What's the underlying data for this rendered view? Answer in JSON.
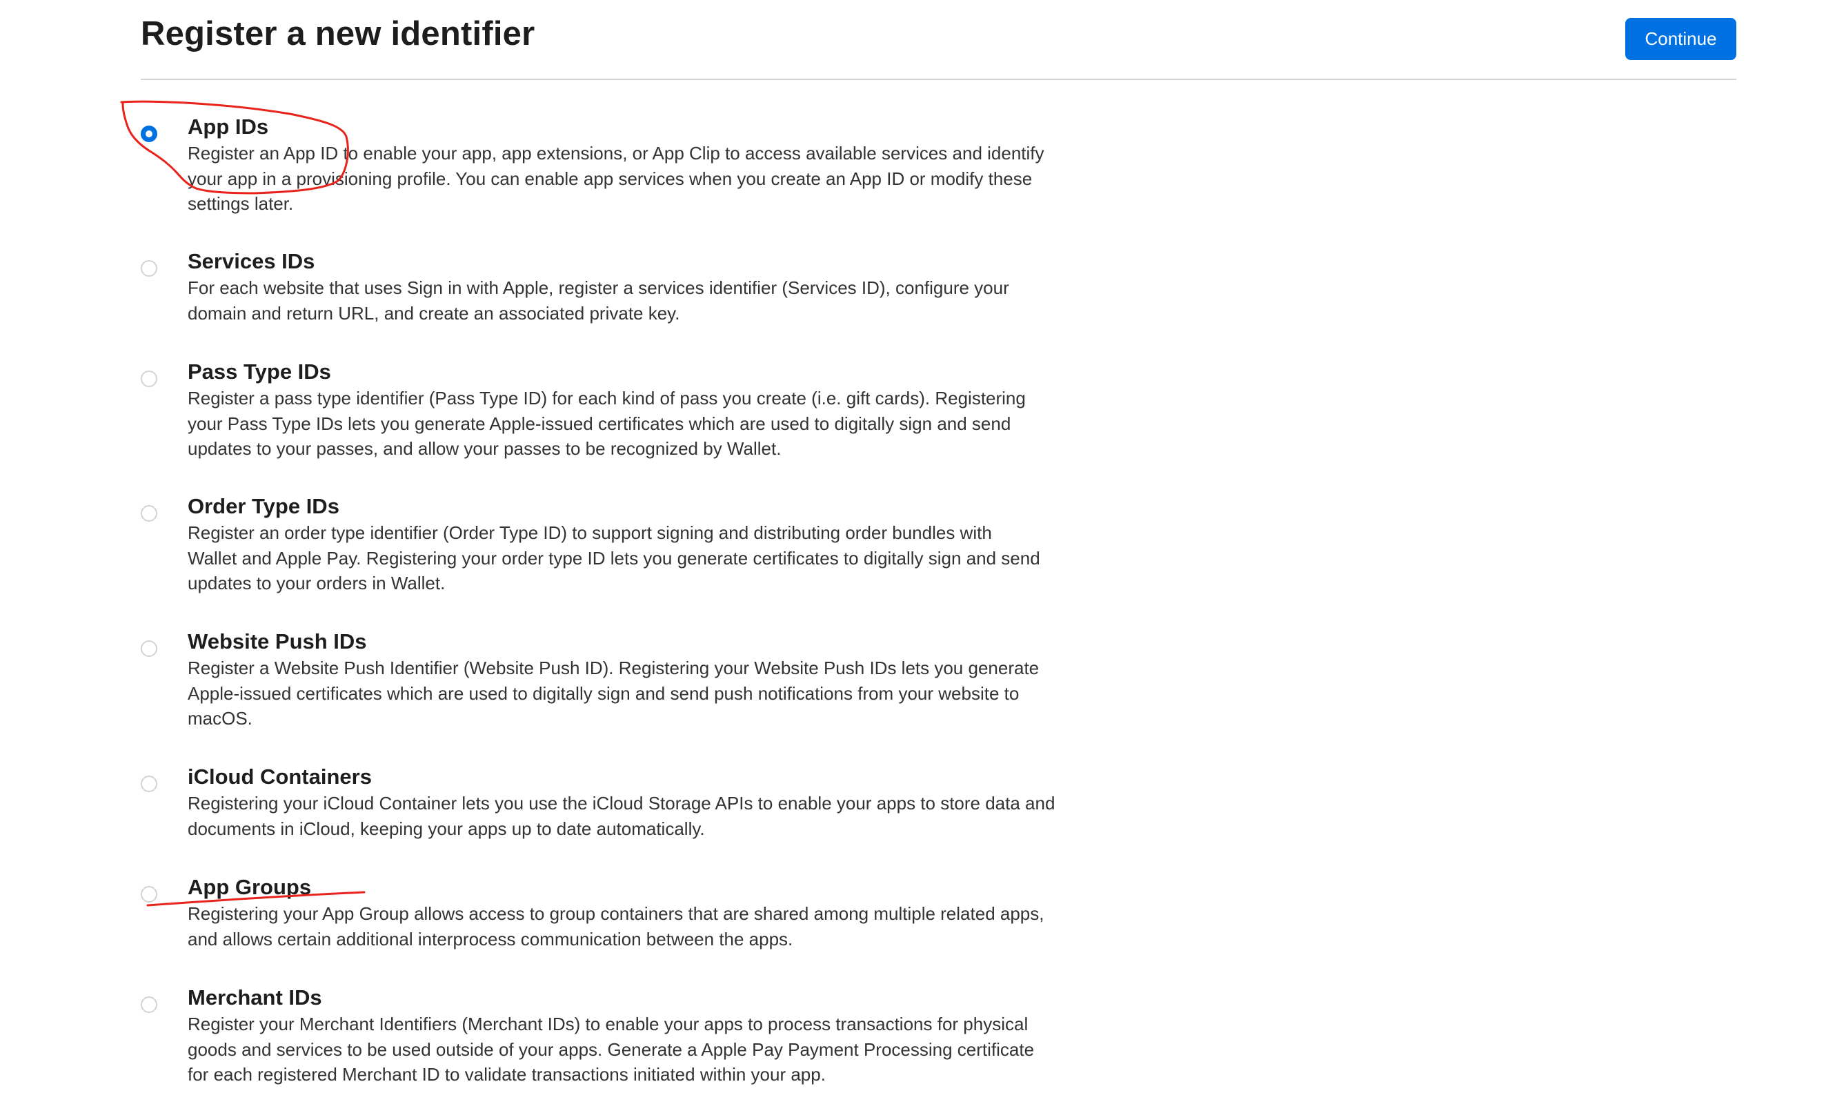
{
  "header": {
    "title": "Register a new identifier",
    "continue_label": "Continue"
  },
  "options": [
    {
      "title": "App IDs",
      "description": "Register an App ID to enable your app, app extensions, or App Clip to access available services and identify\nyour app in a provisioning profile. You can enable app services when you create an App ID or modify these\nsettings later.",
      "selected": true
    },
    {
      "title": "Services IDs",
      "description": "For each website that uses Sign in with Apple, register a services identifier (Services ID), configure your\ndomain and return URL, and create an associated private key.",
      "selected": false
    },
    {
      "title": "Pass Type IDs",
      "description": "Register a pass type identifier (Pass Type ID) for each kind of pass you create (i.e. gift cards). Registering\nyour Pass Type IDs lets you generate Apple-issued certificates which are used to digitally sign and send\nupdates to your passes, and allow your passes to be recognized by Wallet.",
      "selected": false
    },
    {
      "title": "Order Type IDs",
      "description": "Register an order type identifier (Order Type ID) to support signing and distributing order bundles with\nWallet and Apple Pay. Registering your order type ID lets you generate certificates to digitally sign and send\nupdates to your orders in Wallet.",
      "selected": false
    },
    {
      "title": "Website Push IDs",
      "description": "Register a Website Push Identifier (Website Push ID). Registering your Website Push IDs lets you generate\nApple-issued certificates which are used to digitally sign and send push notifications from your website to\nmacOS.",
      "selected": false
    },
    {
      "title": "iCloud Containers",
      "description": "Registering your iCloud Container lets you use the iCloud Storage APIs to enable your apps to store data and\ndocuments in iCloud, keeping your apps up to date automatically.",
      "selected": false
    },
    {
      "title": "App Groups",
      "description": "Registering your App Group allows access to group containers that are shared among multiple related apps,\nand allows certain additional interprocess communication between the apps.",
      "selected": false
    },
    {
      "title": "Merchant IDs",
      "description": "Register your Merchant Identifiers (Merchant IDs) to enable your apps to process transactions for physical\ngoods and services to be used outside of your apps. Generate a Apple Pay Payment Processing certificate\nfor each registered Merchant ID to validate transactions initiated within your app.",
      "selected": false
    }
  ],
  "colors": {
    "accent": "#0071e3",
    "annotation": "#e8231b"
  },
  "annotations": [
    {
      "type": "freehand-circle",
      "target": "App IDs"
    },
    {
      "type": "underline",
      "target": "App Groups"
    }
  ]
}
